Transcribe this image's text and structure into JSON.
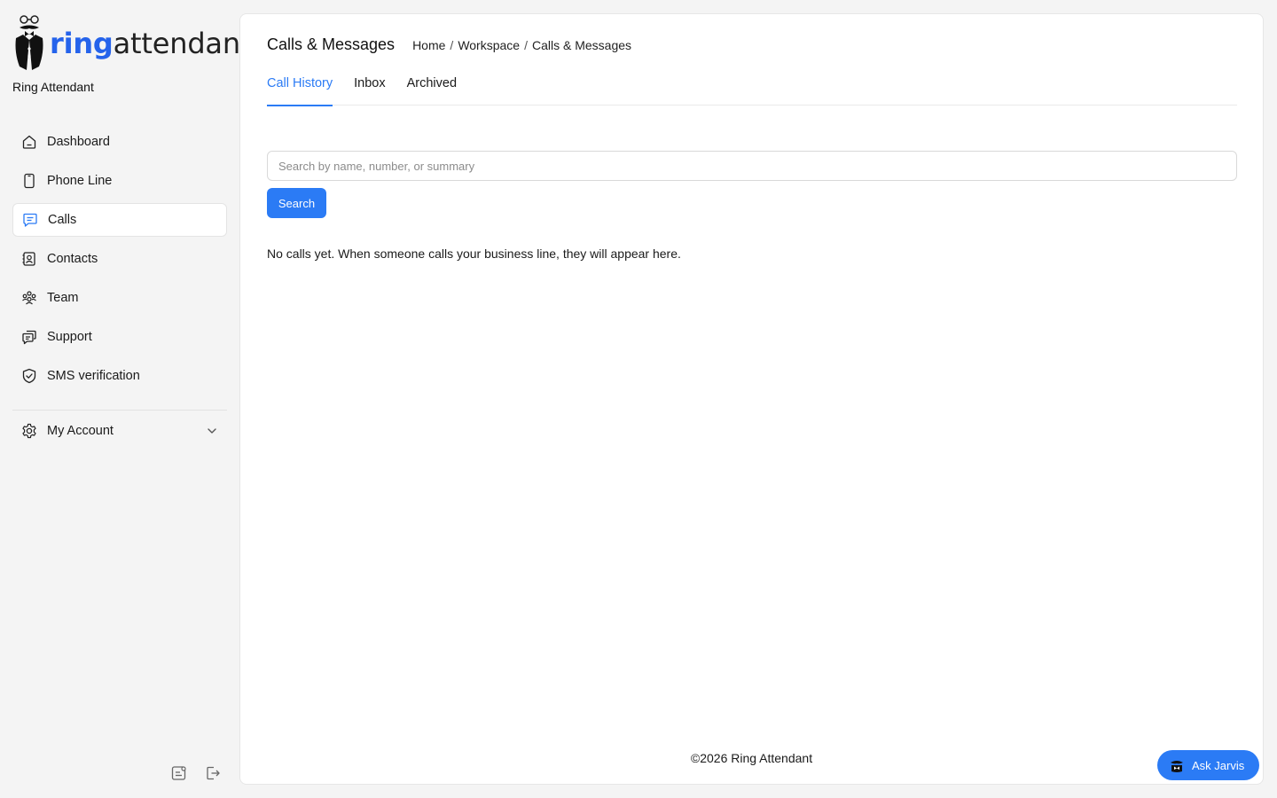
{
  "brand": {
    "logo_ring": "ring",
    "logo_attendant": "attendant",
    "name": "Ring Attendant"
  },
  "sidebar": {
    "items": [
      {
        "label": "Dashboard",
        "icon": "home-icon",
        "active": false
      },
      {
        "label": "Phone Line",
        "icon": "phone-icon",
        "active": false
      },
      {
        "label": "Calls",
        "icon": "message-icon",
        "active": true
      },
      {
        "label": "Contacts",
        "icon": "contacts-icon",
        "active": false
      },
      {
        "label": "Team",
        "icon": "team-icon",
        "active": false
      },
      {
        "label": "Support",
        "icon": "chat-icon",
        "active": false
      },
      {
        "label": "SMS verification",
        "icon": "shield-check-icon",
        "active": false
      }
    ],
    "account_label": "My Account"
  },
  "header": {
    "title": "Calls & Messages",
    "breadcrumb": [
      "Home",
      "Workspace",
      "Calls & Messages"
    ]
  },
  "tabs": [
    {
      "label": "Call History",
      "active": true
    },
    {
      "label": "Inbox",
      "active": false
    },
    {
      "label": "Archived",
      "active": false
    }
  ],
  "search": {
    "placeholder": "Search by name, number, or summary",
    "value": "",
    "button_label": "Search"
  },
  "empty_message": "No calls yet. When someone calls your business line, they will appear here.",
  "footer": "©2026 Ring Attendant",
  "jarvis_label": "Ask Jarvis",
  "colors": {
    "accent": "#2b7bf5",
    "background": "#f4f4f4",
    "panel": "#ffffff"
  }
}
